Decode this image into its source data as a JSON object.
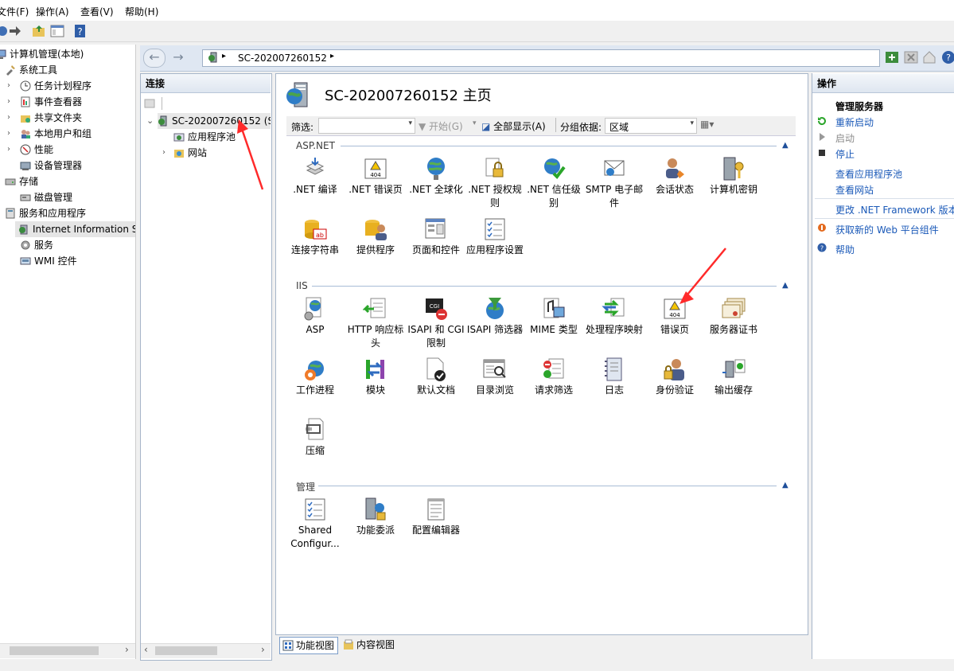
{
  "menu": {
    "items": [
      "文件(F)",
      "操作(A)",
      "查看(V)",
      "帮助(H)"
    ]
  },
  "lefttree": {
    "root": "计算机管理(本地)",
    "nodes": [
      {
        "label": "系统工具",
        "level": 1
      },
      {
        "label": "任务计划程序",
        "level": 2
      },
      {
        "label": "事件查看器",
        "level": 2
      },
      {
        "label": "共享文件夹",
        "level": 2
      },
      {
        "label": "本地用户和组",
        "level": 2
      },
      {
        "label": "性能",
        "level": 2
      },
      {
        "label": "设备管理器",
        "level": 2
      },
      {
        "label": "存储",
        "level": 1
      },
      {
        "label": "磁盘管理",
        "level": 2
      },
      {
        "label": "服务和应用程序",
        "level": 1
      },
      {
        "label": "Internet Information S",
        "level": 2
      },
      {
        "label": "服务",
        "level": 2
      },
      {
        "label": "WMI 控件",
        "level": 2
      }
    ]
  },
  "address": {
    "crumb": "SC-202007260152"
  },
  "connections": {
    "header": "连接",
    "server": "SC-202007260152 (S",
    "child1": "应用程序池",
    "child2": "网站"
  },
  "center": {
    "title": "SC-202007260152 主页",
    "filter": {
      "label": "筛选:",
      "start": "开始(G)",
      "showall": "全部显示(A)",
      "groupby": "分组依据:",
      "groupval": "区域"
    },
    "groups": [
      {
        "name": "ASP.NET"
      },
      {
        "name": "IIS"
      },
      {
        "name": "管理"
      }
    ],
    "aspnet": [
      ".NET 编译",
      ".NET 错误页",
      ".NET 全球化",
      ".NET 授权规则",
      ".NET 信任级别",
      "SMTP 电子邮件",
      "会话状态",
      "计算机密钥",
      "连接字符串",
      "提供程序",
      "页面和控件",
      "应用程序设置"
    ],
    "iis": [
      "ASP",
      "HTTP 响应标头",
      "ISAPI 和 CGI 限制",
      "ISAPI 筛选器",
      "MIME 类型",
      "处理程序映射",
      "错误页",
      "服务器证书",
      "工作进程",
      "模块",
      "默认文档",
      "目录浏览",
      "请求筛选",
      "日志",
      "身份验证",
      "输出缓存",
      "压缩"
    ],
    "mgmt": [
      "Shared Configur...",
      "功能委派",
      "配置编辑器"
    ]
  },
  "actions": {
    "header": "操作",
    "section": "管理服务器",
    "restart": "重新启动",
    "start": "启动",
    "stop": "停止",
    "viewpools": "查看应用程序池",
    "viewsites": "查看网站",
    "changefw": "更改 .NET Framework 版本",
    "getweb": "获取新的 Web 平台组件",
    "help": "帮助"
  },
  "bottomtabs": {
    "features": "功能视图",
    "content": "内容视图"
  },
  "colors": {
    "accent": "#1a59b8",
    "arrow": "#ff2a2a"
  }
}
